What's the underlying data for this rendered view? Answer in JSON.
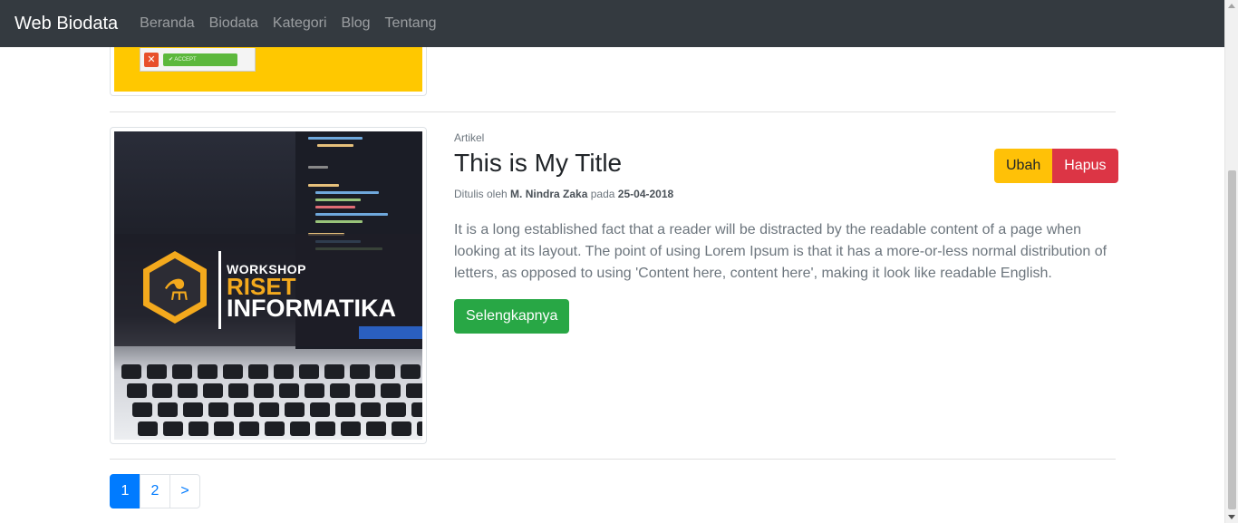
{
  "navbar": {
    "brand": "Web Biodata",
    "links": [
      "Beranda",
      "Biodata",
      "Kategori",
      "Blog",
      "Tentang"
    ]
  },
  "prev_post": {
    "image_button": "ACCEPT"
  },
  "post": {
    "category": "Artikel",
    "title": "This is My Title",
    "byline_prefix": "Ditulis oleh",
    "author": "M. Nindra Zaka",
    "byline_mid": "pada",
    "date": "25-04-2018",
    "excerpt": "It is a long established fact that a reader will be distracted by the readable content of a page when looking at its layout. The point of using Lorem Ipsum is that it has a more-or-less normal distribution of letters, as opposed to using 'Content here, content here', making it look like readable English.",
    "read_more_label": "Selengkapnya",
    "edit_label": "Ubah",
    "delete_label": "Hapus",
    "image_text": {
      "line1": "WORKSHOP",
      "line2": "RISET",
      "line3": "INFORMATIKA"
    }
  },
  "pagination": {
    "pages": [
      "1",
      "2"
    ],
    "next": ">",
    "active": "1"
  },
  "colors": {
    "navbar_bg": "#343a40",
    "success": "#28a745",
    "warning": "#ffc107",
    "danger": "#dc3545",
    "primary": "#007bff"
  }
}
